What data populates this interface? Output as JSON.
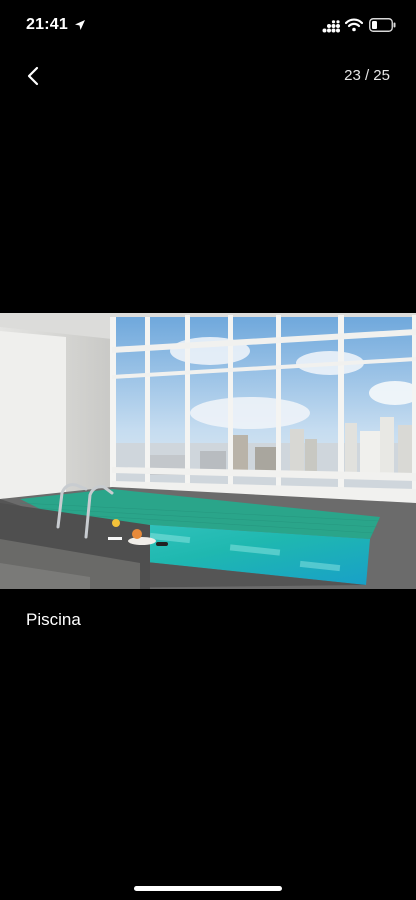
{
  "status_bar": {
    "time": "21:41",
    "icons": [
      "location-arrow-icon",
      "cellular-signal-icon",
      "wifi-icon",
      "battery-icon"
    ]
  },
  "nav": {
    "back_icon": "chevron-left-icon",
    "counter": "23 / 25"
  },
  "photo": {
    "subject": "indoor pool with city view",
    "colors": {
      "water": "#1fb8b0",
      "tile": "#2aa58a",
      "sky": "#9dc6e8"
    }
  },
  "caption": "Piscina"
}
